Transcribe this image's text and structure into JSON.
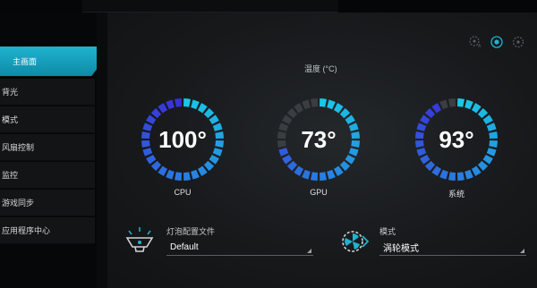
{
  "sidebar": {
    "items": [
      {
        "label": "主画面",
        "active": true
      },
      {
        "label": "背光"
      },
      {
        "label": "模式"
      },
      {
        "label": "风扇控制"
      },
      {
        "label": "监控"
      },
      {
        "label": "游戏同步"
      },
      {
        "label": "应用程序中心"
      }
    ]
  },
  "main": {
    "title": "温度 (°C)",
    "gauges": [
      {
        "label": "CPU",
        "value_text": "100°",
        "value": 100
      },
      {
        "label": "GPU",
        "value_text": "73°",
        "value": 73
      },
      {
        "label": "系统",
        "value_text": "93°",
        "value": 93
      }
    ],
    "bulb_profile": {
      "label": "灯泡配置文件",
      "value": "Default"
    },
    "mode": {
      "label": "模式",
      "value": "涡轮模式"
    }
  },
  "colors": {
    "accent": "#1fb3cf",
    "gauge_start": "#19c8e6",
    "gauge_end": "#3a2fd8",
    "gauge_empty": "#3a3e42"
  },
  "icons": [
    "fan-auto-icon",
    "power-icon",
    "fan-icon",
    "bulb-icon",
    "turbo-fan-icon"
  ]
}
